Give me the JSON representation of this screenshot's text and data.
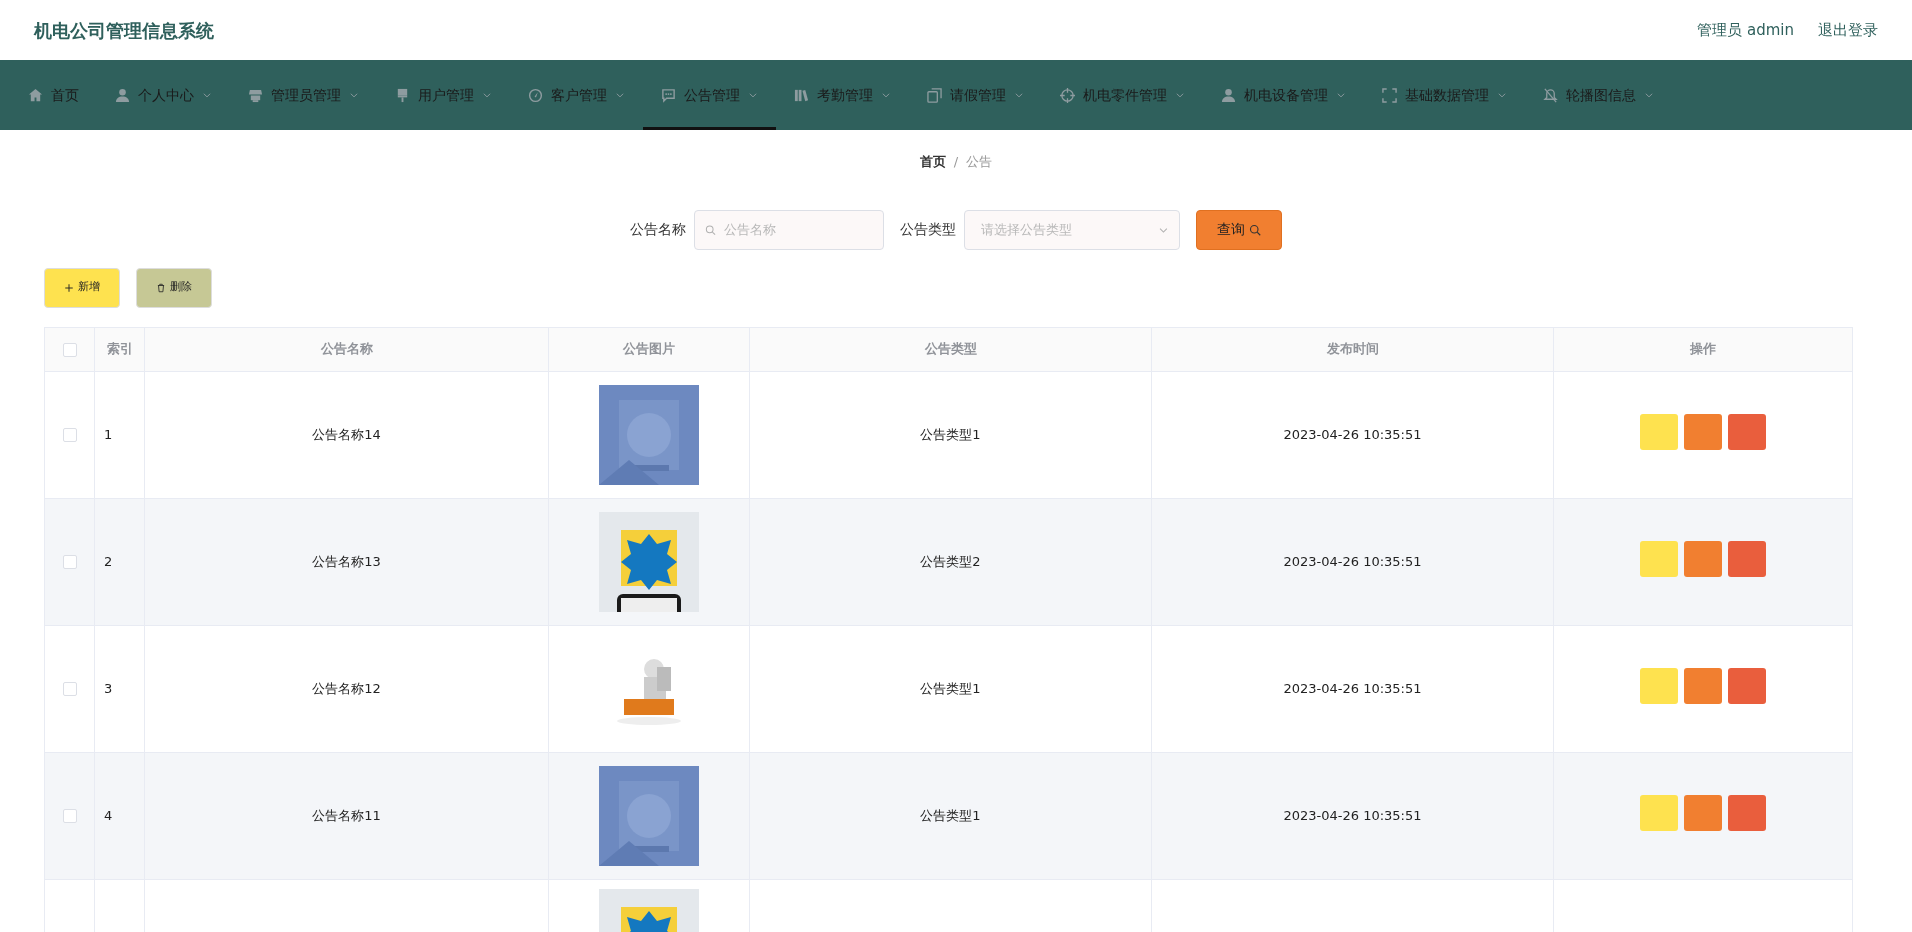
{
  "header": {
    "title": "机电公司管理信息系统",
    "user": "管理员 admin",
    "logout": "退出登录"
  },
  "nav": [
    {
      "label": "首页",
      "dropdown": false,
      "selected": false
    },
    {
      "label": "个人中心",
      "dropdown": true,
      "selected": false
    },
    {
      "label": "管理员管理",
      "dropdown": true,
      "selected": false
    },
    {
      "label": "用户管理",
      "dropdown": true,
      "selected": false
    },
    {
      "label": "客户管理",
      "dropdown": true,
      "selected": false
    },
    {
      "label": "公告管理",
      "dropdown": true,
      "selected": true
    },
    {
      "label": "考勤管理",
      "dropdown": true,
      "selected": false
    },
    {
      "label": "请假管理",
      "dropdown": true,
      "selected": false
    },
    {
      "label": "机电零件管理",
      "dropdown": true,
      "selected": false
    },
    {
      "label": "机电设备管理",
      "dropdown": true,
      "selected": false
    },
    {
      "label": "基础数据管理",
      "dropdown": true,
      "selected": false
    },
    {
      "label": "轮播图信息",
      "dropdown": true,
      "selected": false
    }
  ],
  "breadcrumb": {
    "separator": "/",
    "items": [
      {
        "label": "首页",
        "current": false
      },
      {
        "label": "公告",
        "current": true
      }
    ]
  },
  "search": {
    "name_label": "公告名称",
    "name_placeholder": "公告名称",
    "type_label": "公告类型",
    "type_placeholder": "请选择公告类型",
    "button": "查询"
  },
  "toolbar": [
    {
      "label": "新增",
      "kind": "add"
    },
    {
      "label": "删除",
      "kind": "delete"
    }
  ],
  "table": {
    "select_all_checked": false,
    "columns": [
      "索引",
      "公告名称",
      "公告图片",
      "公告类型",
      "发布时间",
      "操作"
    ],
    "rows": [
      {
        "checked": false,
        "index": "1",
        "name": "公告名称14",
        "image": {
          "kind": "picture"
        },
        "type": "公告类型1",
        "time": "2023-04-26 10:35:51",
        "actions": [
          {
            "kind": "view"
          },
          {
            "kind": "edit"
          },
          {
            "kind": "delete"
          }
        ]
      },
      {
        "checked": false,
        "index": "2",
        "name": "公告名称13",
        "image": {
          "kind": "picture"
        },
        "type": "公告类型2",
        "time": "2023-04-26 10:35:51",
        "actions": [
          {
            "kind": "view"
          },
          {
            "kind": "edit"
          },
          {
            "kind": "delete"
          }
        ]
      },
      {
        "checked": false,
        "index": "3",
        "name": "公告名称12",
        "image": {
          "kind": "picture"
        },
        "type": "公告类型1",
        "time": "2023-04-26 10:35:51",
        "actions": [
          {
            "kind": "view"
          },
          {
            "kind": "edit"
          },
          {
            "kind": "delete"
          }
        ]
      },
      {
        "checked": false,
        "index": "4",
        "name": "公告名称11",
        "image": {
          "kind": "picture"
        },
        "type": "公告类型1",
        "time": "2023-04-26 10:35:51",
        "actions": [
          {
            "kind": "view"
          },
          {
            "kind": "edit"
          },
          {
            "kind": "delete"
          }
        ]
      },
      {
        "image": {
          "kind": "picture"
        }
      }
    ]
  }
}
